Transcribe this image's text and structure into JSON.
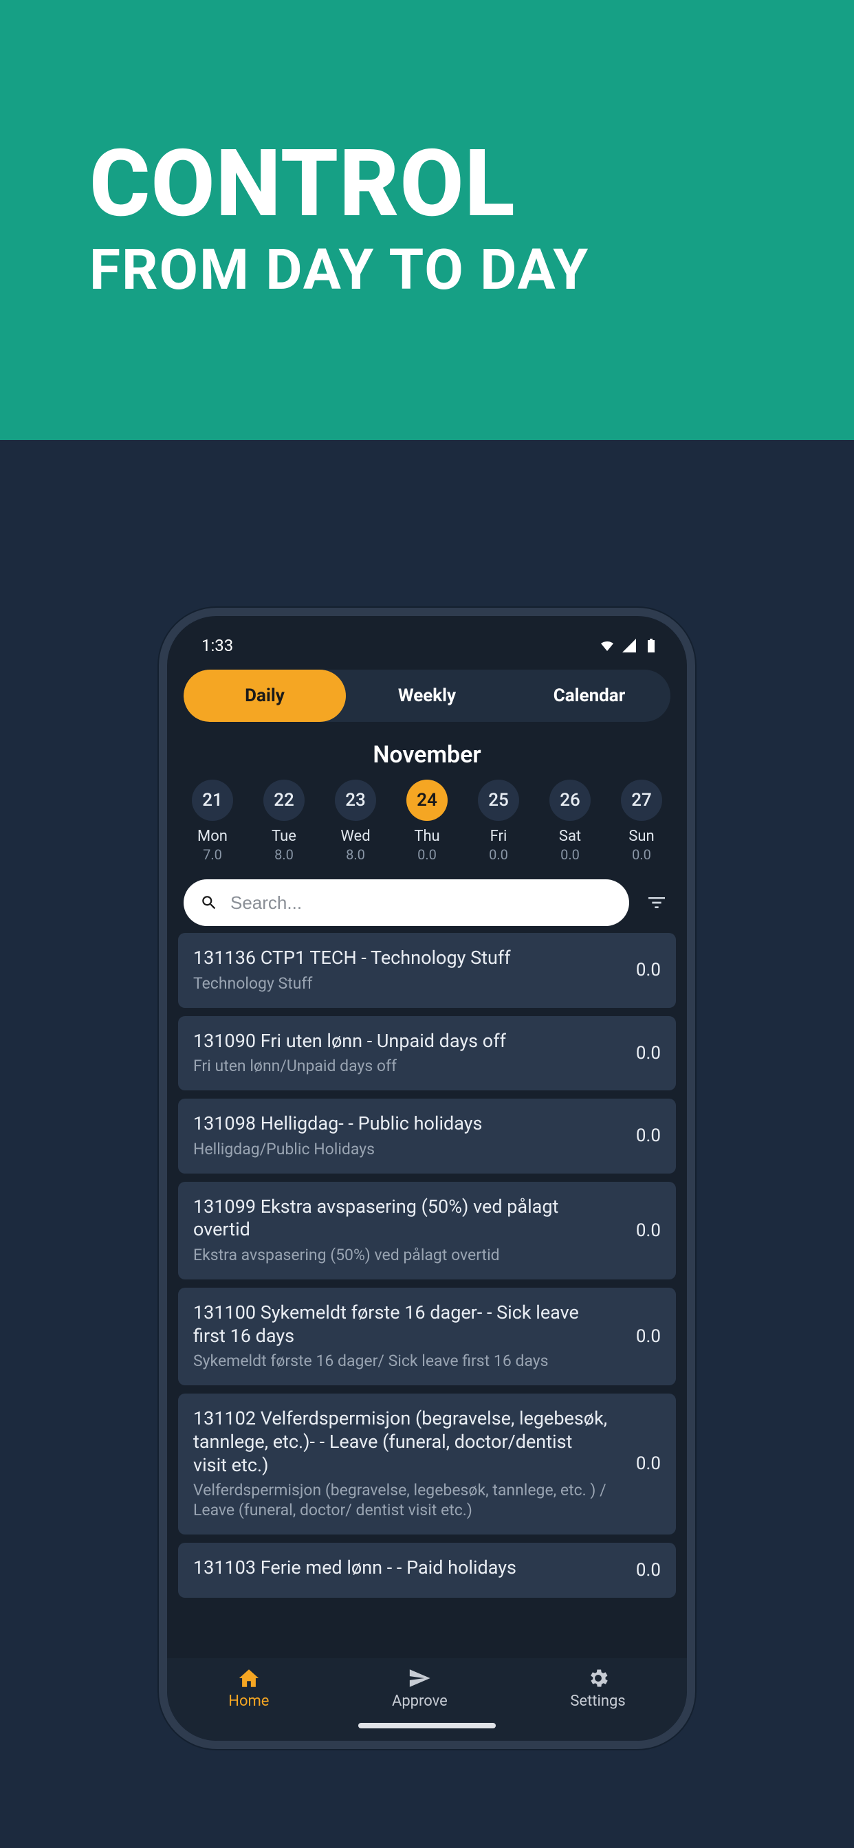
{
  "hero": {
    "title": "CONTROL",
    "subtitle": "FROM DAY TO DAY"
  },
  "status": {
    "time": "1:33"
  },
  "seg": {
    "daily": "Daily",
    "weekly": "Weekly",
    "calendar": "Calendar"
  },
  "month": "November",
  "days": [
    {
      "num": "21",
      "name": "Mon",
      "hours": "7.0"
    },
    {
      "num": "22",
      "name": "Tue",
      "hours": "8.0"
    },
    {
      "num": "23",
      "name": "Wed",
      "hours": "8.0"
    },
    {
      "num": "24",
      "name": "Thu",
      "hours": "0.0"
    },
    {
      "num": "25",
      "name": "Fri",
      "hours": "0.0"
    },
    {
      "num": "26",
      "name": "Sat",
      "hours": "0.0"
    },
    {
      "num": "27",
      "name": "Sun",
      "hours": "0.0"
    }
  ],
  "search": {
    "placeholder": "Search..."
  },
  "items": [
    {
      "title": "131136 CTP1 TECH - Technology Stuff",
      "sub": "Technology Stuff",
      "value": "0.0"
    },
    {
      "title": "131090 Fri uten lønn - Unpaid days off",
      "sub": "Fri uten lønn/Unpaid days off",
      "value": "0.0"
    },
    {
      "title": "131098 Helligdag- - Public holidays",
      "sub": "Helligdag/Public Holidays",
      "value": "0.0"
    },
    {
      "title": "131099 Ekstra avspasering (50%) ved pålagt overtid",
      "sub": "Ekstra avspasering (50%) ved pålagt overtid",
      "value": "0.0"
    },
    {
      "title": "131100 Sykemeldt første 16 dager- - Sick leave first 16 days",
      "sub": "Sykemeldt første 16 dager/ Sick leave first 16 days",
      "value": "0.0"
    },
    {
      "title": "131102 Velferdspermisjon (begravelse, legebesøk, tannlege, etc.)- - Leave (funeral, doctor/dentist visit etc.)",
      "sub": "Velferdspermisjon (begravelse, legebesøk, tannlege, etc. ) / Leave (funeral, doctor/ dentist visit etc.)",
      "value": "0.0"
    },
    {
      "title": "131103 Ferie med lønn - - Paid holidays",
      "sub": "",
      "value": "0.0"
    }
  ],
  "tabs": {
    "home": "Home",
    "approve": "Approve",
    "settings": "Settings"
  }
}
